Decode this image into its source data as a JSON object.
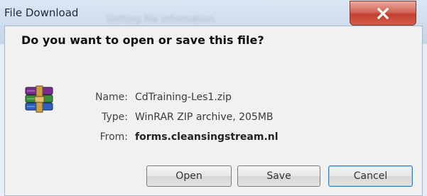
{
  "window": {
    "title": "File Download",
    "blurred_caption": "Getting file information"
  },
  "dialog": {
    "question": "Do you want to open or save this file?",
    "file_icon": "winrar-archive-icon",
    "fields": {
      "name_label": "Name:",
      "name_value": "CdTraining-Les1.zip",
      "type_label": "Type:",
      "type_value": "WinRAR ZIP archive, 205MB",
      "from_label": "From:",
      "from_value": "forms.cleansingstream.nl"
    }
  },
  "buttons": {
    "open_label": "Open",
    "save_label": "Save",
    "cancel_label": "Cancel"
  },
  "colors": {
    "close_button": "#c2402f",
    "focus_border": "#3c7fb1"
  }
}
